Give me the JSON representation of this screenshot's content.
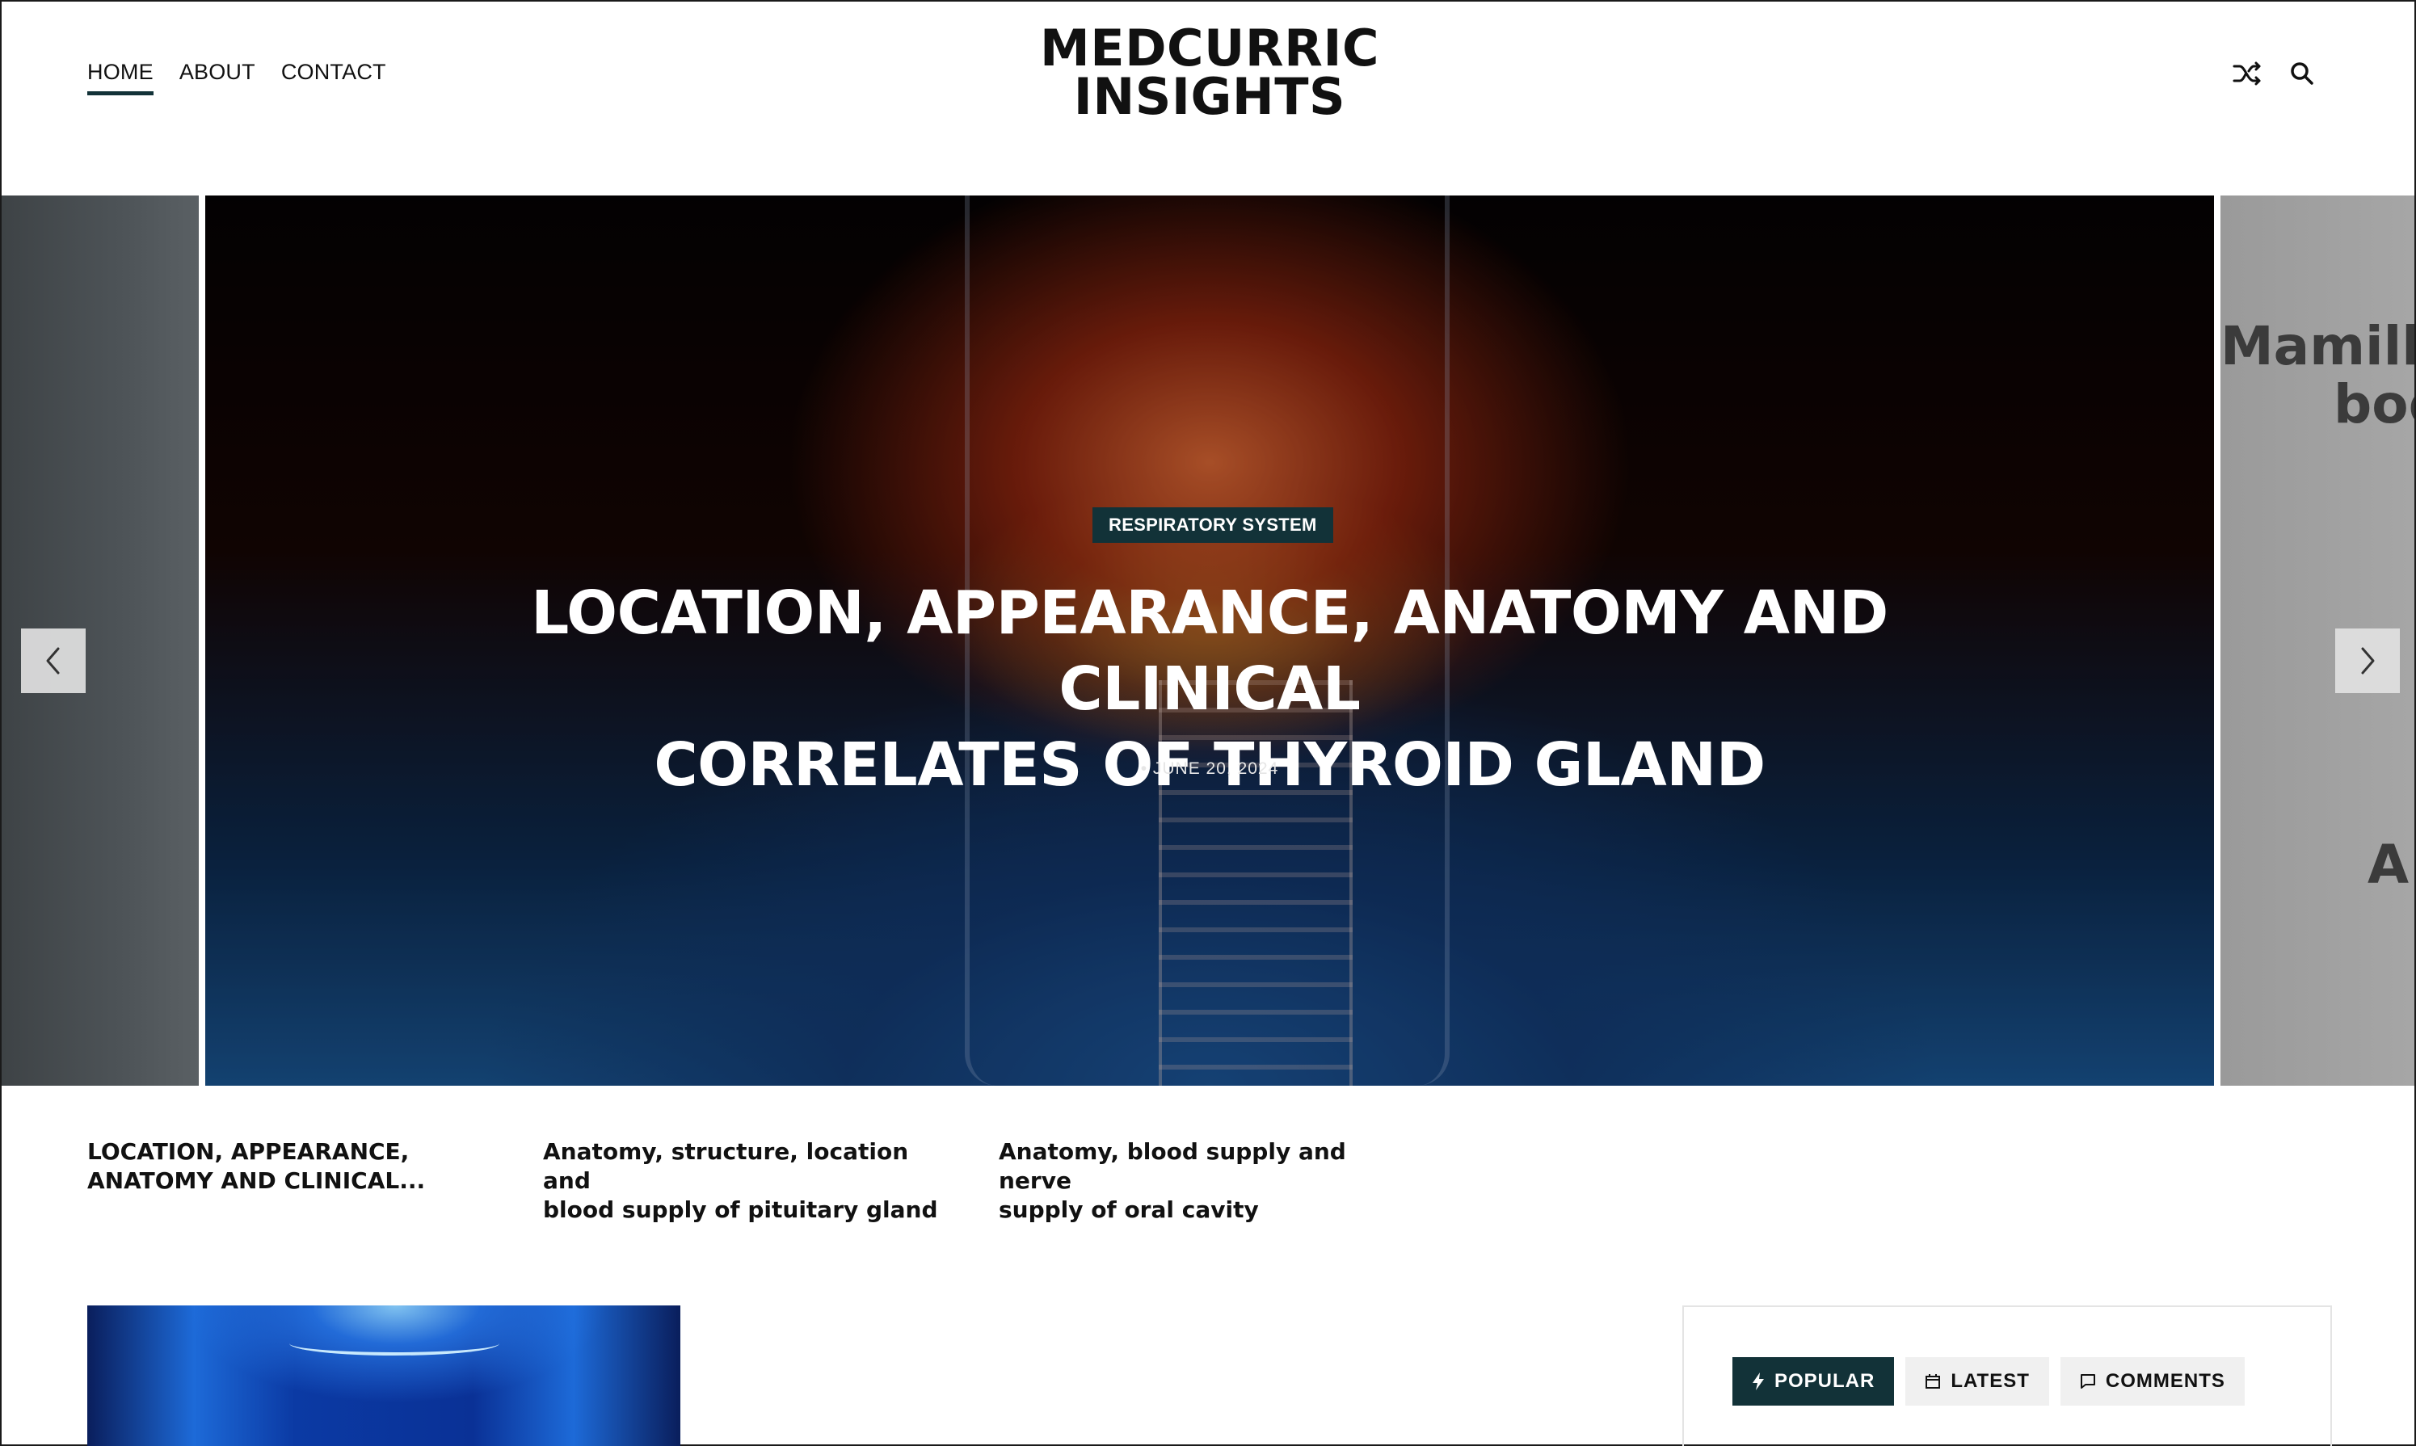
{
  "header": {
    "nav": [
      {
        "label": "HOME",
        "active": true
      },
      {
        "label": "ABOUT",
        "active": false
      },
      {
        "label": "CONTACT",
        "active": false
      }
    ],
    "logo_line1": "MEDCURRIC",
    "logo_line2": "INSIGHTS",
    "icons": [
      "shuffle-icon",
      "search-icon"
    ]
  },
  "slider": {
    "category": "RESPIRATORY SYSTEM",
    "title_line1": "LOCATION, APPEARANCE, ANATOMY AND CLINICAL",
    "title_line2": "CORRELATES OF THYROID GLAND",
    "date": "• JUNE 20, 2024",
    "next_slide_text1": "Mamillar",
    "next_slide_text2": "bod",
    "next_slide_text3": "A"
  },
  "thumbs": [
    {
      "line1": "LOCATION, APPEARANCE,",
      "line2": "ANATOMY AND CLINICAL..."
    },
    {
      "line1": "Anatomy, structure, location and",
      "line2": "blood supply of pituitary gland"
    },
    {
      "line1": "Anatomy, blood supply and nerve",
      "line2": "supply of oral cavity"
    }
  ],
  "widget": {
    "tabs": [
      {
        "label": "POPULAR",
        "icon": "bolt-icon",
        "active": true
      },
      {
        "label": "LATEST",
        "icon": "calendar-icon",
        "active": false
      },
      {
        "label": "COMMENTS",
        "icon": "comment-icon",
        "active": false
      }
    ]
  },
  "colors": {
    "accent": "#123238"
  }
}
